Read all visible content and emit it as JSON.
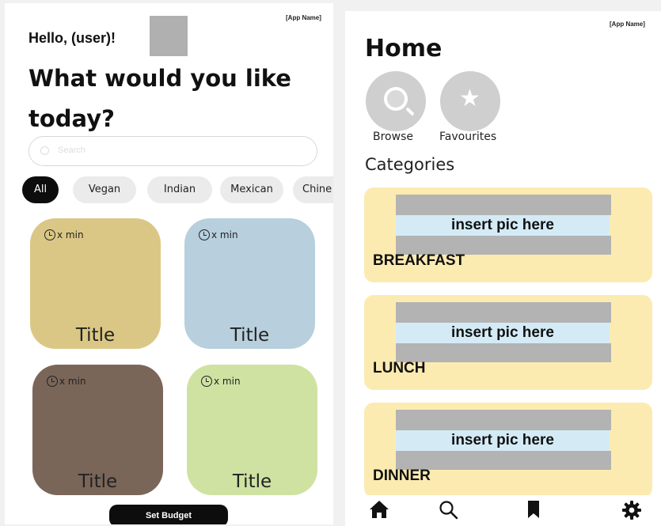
{
  "left_screen": {
    "app_name": "[App Name]",
    "greeting": "Hello, (user)!",
    "question": "What would you like today?",
    "search_placeholder": "Search",
    "filters": [
      "All",
      "Vegan",
      "Indian",
      "Mexican",
      "Chine"
    ],
    "active_filter": "All",
    "recipes": [
      {
        "time": "x min",
        "title": "Title",
        "color": "#dbc785"
      },
      {
        "time": "x min",
        "title": "Title",
        "color": "#b8cfdd"
      },
      {
        "time": "x min",
        "title": "Title",
        "color": "#7a6659"
      },
      {
        "time": "x min",
        "title": "Title",
        "color": "#cfe2a2"
      }
    ],
    "budget_button": "Set Budget"
  },
  "right_screen": {
    "app_name": "[App Name]",
    "title": "Home",
    "quick_actions": [
      {
        "label": "Browse",
        "icon": "search-icon"
      },
      {
        "label": "Favourites",
        "icon": "star-icon"
      }
    ],
    "categories_heading": "Categories",
    "categories": [
      {
        "placeholder": "insert pic here",
        "name": "BREAKFAST"
      },
      {
        "placeholder": "insert pic here",
        "name": "LUNCH"
      },
      {
        "placeholder": "insert pic here",
        "name": "DINNER"
      }
    ],
    "tab_bar": [
      "home-icon",
      "search-icon",
      "bookmark-icon",
      "settings-icon"
    ]
  },
  "colors": {
    "category_card": "#fcebb1",
    "placeholder_gray": "#b3b3b3",
    "placeholder_blue": "#d4ebf6",
    "primary_dark": "#0d0d0d"
  }
}
